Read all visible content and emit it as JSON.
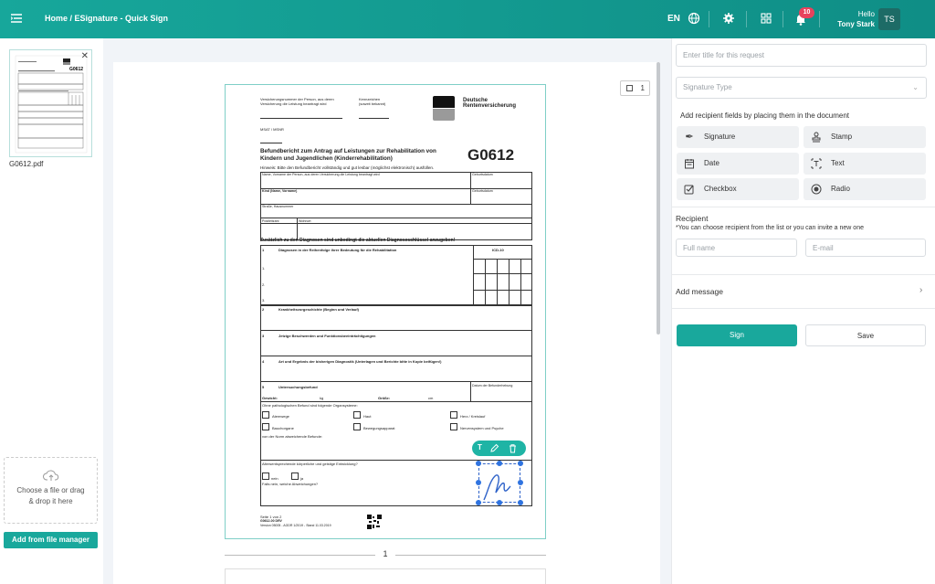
{
  "header": {
    "breadcrumb": "Home / ESignature - Quick Sign",
    "language": "EN",
    "notification_count": "10",
    "greeting": "Hello",
    "user_name": "Tony Stark",
    "avatar_initials": "TS"
  },
  "left_panel": {
    "file_name": "G0612.pdf",
    "drop_line1": "Choose a file or drag",
    "drop_line2": "& drop it here",
    "add_button": "Add from file manager"
  },
  "viewer": {
    "page_counter": "1",
    "page_number": "1"
  },
  "document": {
    "hdr_insured1": "Versicherungsnummer der Person, aus deren",
    "hdr_insured2": "Versicherung die Leistung beantragt wird",
    "hdr_kenn1": "Kennzeichen",
    "hdr_kenn2": "(soweit bekannt)",
    "logo_text1": "Deutsche",
    "logo_text2": "Rentenversicherung",
    "msnr": "MSAT / MSNR",
    "title1": "Befundbericht zum Antrag auf Leistungen zur Rehabilitation von",
    "title2": "Kindern und Jugendlichen (Kinderrehabilitation)",
    "form_code": "G0612",
    "hint": "Hinweis: Bitte den Befundbericht vollständig und gut lesbar (möglichst elektronisch) ausfüllen.",
    "row_name": "Name, Vorname der Person, aus deren Versicherung die Leistung beantragt wird",
    "row_geb": "Geburtsdatum",
    "row_kind": "Kind (Name, Vorname)",
    "row_street": "Straße, Hausnummer",
    "row_plz": "Postleitzahl",
    "row_ort": "Wohnort",
    "diag_hint": "Zusätzlich zu den Diagnosen sind unbedingt die aktuellen Diagnoseschlüssel anzugeben!",
    "s1_num": "1",
    "s1": "Diagnosen in der Reihenfolge ihrer Bedeutung für die Rehabilitation",
    "icd": "ICD-10",
    "d1": "1.",
    "d2": "2.",
    "d3": "3.",
    "s2_num": "2",
    "s2": "Krankheitsvorgeschichte (Beginn und Verlauf)",
    "s3_num": "3",
    "s3": "Jetzige Beschwerden und Funktionsbeeinträchtigungen",
    "s4_num": "4",
    "s4": "Art und Ergebnis der bisherigen Diagnostik (Unterlagen und Berichte bitte in Kopie beifügen!)",
    "s5_num": "5",
    "s5": "Untersuchungsbefund",
    "s5_date": "Datum der Befunderhebung",
    "gewicht": "Gewicht:",
    "kg": "kg",
    "groesse": "Größe:",
    "cm": "cm",
    "organ": "Ohne pathologischen Befund sind folgende Organsysteme:",
    "cb_atem": "Atemwege",
    "cb_haut": "Haut",
    "cb_herz": "Herz / Kreislauf",
    "cb_bauch": "Bauchorgane",
    "cb_bewegung": "Bewegungsapparat",
    "cb_nerven": "Nervensystem und Psyche",
    "abweichend": "von der Norm abweichende Befunde:",
    "entwicklung": "Altersentsprechende körperliche und geistige Entwicklung?",
    "nein": "nein",
    "ja": "ja",
    "falls": "Falls nein, welche Abweichungen?",
    "footer1": "Seite 1 von 2",
    "footer2": "G0612-00 DRV",
    "footer3": "Version 05005 - AGDR 1/2019 - Stand 11.03.2019"
  },
  "toolbar_popup": {
    "text_tool": "T"
  },
  "right_panel": {
    "title_placeholder": "Enter title for this request",
    "signature_type_placeholder": "Signature Type",
    "fields_hint": "Add recipient fields by placing them in the document",
    "fields": [
      {
        "label": "Signature",
        "icon": "signature-icon"
      },
      {
        "label": "Stamp",
        "icon": "stamp-icon"
      },
      {
        "label": "Date",
        "icon": "calendar-icon"
      },
      {
        "label": "Text",
        "icon": "text-icon"
      },
      {
        "label": "Checkbox",
        "icon": "checkbox-icon"
      },
      {
        "label": "Radio",
        "icon": "radio-icon"
      }
    ],
    "recipient_title": "Recipient",
    "recipient_note": "*You can choose recipient from the list or you can invite a new one",
    "fullname_placeholder": "Full name",
    "email_placeholder": "E-mail",
    "add_message": "Add message",
    "sign_button": "Sign",
    "save_button": "Save"
  },
  "colors": {
    "accent": "#19a89c",
    "header_gradient_start": "#17a79b",
    "header_gradient_end": "#0f8e86",
    "badge": "#e8425d",
    "signature_ink": "#2f63c9"
  }
}
